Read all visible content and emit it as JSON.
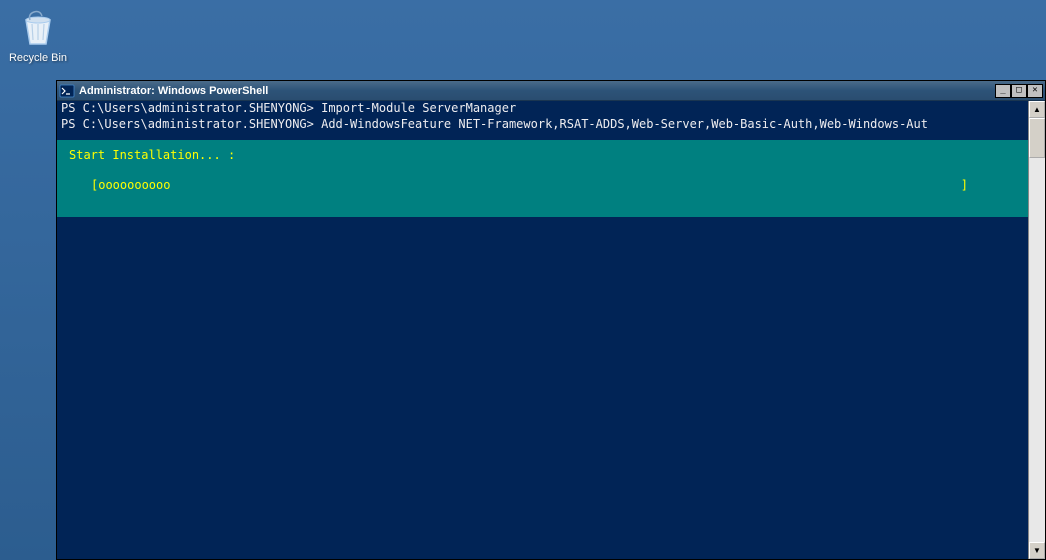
{
  "desktop": {
    "recycle_bin_label": "Recycle Bin"
  },
  "window": {
    "title": "Administrator: Windows PowerShell"
  },
  "console": {
    "prompt1": "PS C:\\Users\\administrator.SHENYONG>",
    "command1": "Import-Module ServerManager",
    "prompt2": "PS C:\\Users\\administrator.SHENYONG>",
    "command2": "Add-WindowsFeature NET-Framework,RSAT-ADDS,Web-Server,Web-Basic-Auth,Web-Windows-Aut",
    "progress": {
      "title": "Start Installation... :",
      "bar_open": "[",
      "bar_fill": "oooooooooo",
      "bar_close": "]"
    }
  },
  "scrollbar": {
    "up": "▲",
    "down": "▼"
  }
}
